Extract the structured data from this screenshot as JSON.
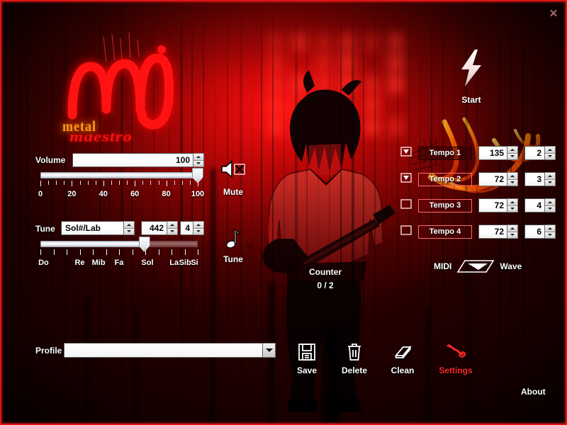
{
  "window": {
    "title": "Maestro",
    "close_label": "✕",
    "frame_color": "#e01414"
  },
  "logo": {
    "mark": "m",
    "wordmark": "maestro",
    "flame_text": "metal"
  },
  "start": {
    "label": "Start",
    "icon": "lightning-bolt-icon"
  },
  "volume": {
    "label": "Volume",
    "value": "100",
    "slider_percent": 100,
    "scale_labels": [
      "0",
      "20",
      "40",
      "60",
      "80",
      "100"
    ],
    "scale_values": [
      0,
      20,
      40,
      60,
      80,
      100
    ],
    "tick_count": 21,
    "mute": {
      "label": "Mute",
      "icon": "speaker-muted-icon",
      "muted": true
    }
  },
  "tune": {
    "label": "Tune",
    "note_value": "Sol#/Lab",
    "frequency": "442",
    "octave": "4",
    "slider_percent": 66,
    "scale_labels": [
      "Do",
      "Re",
      "Mib",
      "Fa",
      "Sol",
      "La",
      "Sib",
      "Si"
    ],
    "scale_positions": [
      2,
      25,
      37,
      50,
      68,
      85,
      92,
      98
    ],
    "tick_count": 13,
    "icon_caption": "Tune",
    "icon": "music-note-icon"
  },
  "tempos": [
    {
      "name": "Tempo 1",
      "bpm": "135",
      "beats": "2",
      "flag": "flag-filled-icon",
      "active": true
    },
    {
      "name": "Tempo 2",
      "bpm": "72",
      "beats": "3",
      "flag": "flag-filled-icon",
      "active": false
    },
    {
      "name": "Tempo 3",
      "bpm": "72",
      "beats": "4",
      "flag": "flag-outline-icon",
      "active": false
    },
    {
      "name": "Tempo 4",
      "bpm": "72",
      "beats": "6",
      "flag": "flag-outline-icon",
      "active": false
    }
  ],
  "counter": {
    "label": "Counter",
    "value": "0 / 2"
  },
  "output_switch": {
    "left_label": "MIDI",
    "right_label": "Wave",
    "selected": "Wave"
  },
  "profile": {
    "label": "Profile",
    "value": "",
    "placeholder": ""
  },
  "toolbar": [
    {
      "label": "Save",
      "icon": "floppy-disk-icon",
      "color": "#ffffff"
    },
    {
      "label": "Delete",
      "icon": "trash-can-icon",
      "color": "#ffffff"
    },
    {
      "label": "Clean",
      "icon": "eraser-icon",
      "color": "#ffffff"
    },
    {
      "label": "Settings",
      "icon": "wrench-icon",
      "color": "#ff2727"
    }
  ],
  "about": {
    "label": "About"
  }
}
